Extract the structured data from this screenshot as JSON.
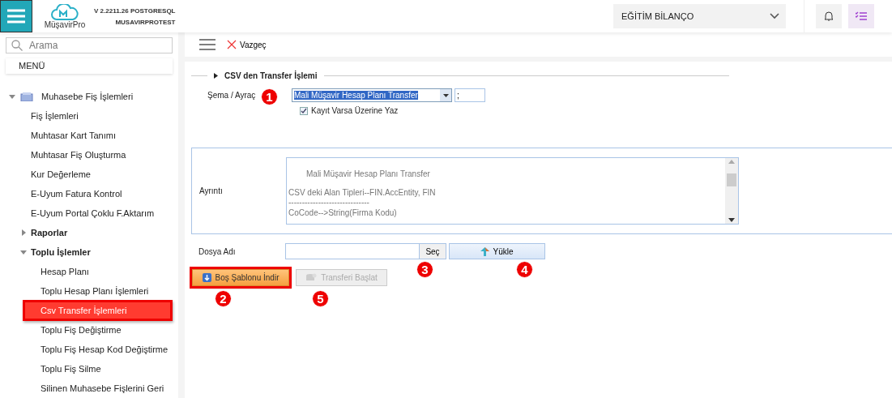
{
  "header": {
    "version": "V 2.2211.26 POSTGRESQL",
    "database": "MUSAVIRPROTEST",
    "logo_text": "MüşavirPro",
    "company_select": {
      "value": "EĞİTİM BİLANÇO"
    }
  },
  "sidebar": {
    "search": {
      "placeholder": "Arama"
    },
    "menu_title": "MENÜ",
    "tree": [
      {
        "label": "Muhasebe Fiş İşlemleri",
        "expanded": true,
        "children": [
          {
            "label": "Fiş İşlemleri",
            "selected": false
          },
          {
            "label": "Muhtasar Kart Tanımı",
            "selected": false
          },
          {
            "label": "Muhtasar Fiş Oluşturma",
            "selected": false
          },
          {
            "label": "Kur Değerleme",
            "selected": false
          },
          {
            "label": "E-Uyum Fatura Kontrol",
            "selected": false
          },
          {
            "label": "E-Uyum Portal Çoklu F.Aktarım",
            "selected": false
          },
          {
            "label": "Raporlar",
            "expanded": false
          },
          {
            "label": "Toplu İşlemler",
            "expanded": true,
            "children": [
              {
                "label": "Hesap Planı",
                "selected": false
              },
              {
                "label": "Toplu Hesap Planı İşlemleri",
                "selected": false
              },
              {
                "label": "Csv Transfer İşlemleri",
                "selected": true
              },
              {
                "label": "Toplu Fiş Değiştirme",
                "selected": false
              },
              {
                "label": "Toplu Fiş Hesap Kod Değiştirme",
                "selected": false
              },
              {
                "label": "Toplu Fiş Silme",
                "selected": false
              },
              {
                "label": "Silinen Muhasebe Fişlerini Geri",
                "selected": false
              }
            ]
          }
        ]
      }
    ]
  },
  "toolbar": {
    "cancel_label": "Vazgeç"
  },
  "section": {
    "title": "CSV den Transfer İşlemi",
    "schema": {
      "label": "Şema / Ayraç",
      "value": "Mali Müşavir Hesap Planı Transfer",
      "separator": ";",
      "marker": "1"
    },
    "overwrite": {
      "label": "Kayıt Varsa Üzerine Yaz",
      "checked": true
    },
    "detail": {
      "label": "Ayrıntı",
      "lines": [
        "Mali Müşavir Hesap Planı Transfer",
        "CSV deki Alan Tipleri--FIN.AccEntity, FIN",
        "------------------------------",
        "CoCode-->String(Firma Kodu)"
      ]
    },
    "file": {
      "label": "Dosya Adı",
      "choose_label": "Seç",
      "choose_marker": "3",
      "upload_label": "Yükle",
      "upload_marker": "4"
    },
    "actions": [
      {
        "label": "Boş Şablonu İndir",
        "kind": "download",
        "disabled": false,
        "highlighted": true,
        "marker": "2"
      },
      {
        "label": "Transferi Başlat",
        "kind": "transfer",
        "disabled": true,
        "highlighted": false,
        "marker": "5"
      }
    ]
  }
}
